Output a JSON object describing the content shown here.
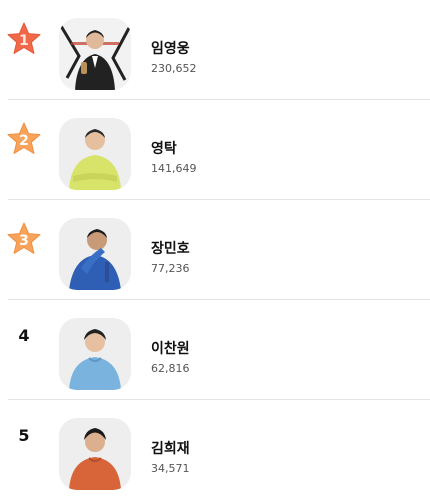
{
  "colors": {
    "star_gold_1": "#f06a4a",
    "star_fill_1": "#f47d54",
    "star_fill_2": "#f7a35c",
    "star_fill_3": "#f7a35c",
    "rank_text_star_1": "#c0392b",
    "rank_text_star": "#ffffff",
    "divider": "#e4e4e4",
    "avatar_bg": "#eeeeee"
  },
  "ranking": [
    {
      "rank": "1",
      "badge_icon": "star-icon",
      "name": "임영웅",
      "count": "230,652",
      "avatar_icon": "person-photo-icon"
    },
    {
      "rank": "2",
      "badge_icon": "star-icon",
      "name": "영탁",
      "count": "141,649",
      "avatar_icon": "person-photo-icon"
    },
    {
      "rank": "3",
      "badge_icon": "star-icon",
      "name": "장민호",
      "count": "77,236",
      "avatar_icon": "person-photo-icon"
    },
    {
      "rank": "4",
      "badge_icon": "none",
      "name": "이찬원",
      "count": "62,816",
      "avatar_icon": "person-photo-icon"
    },
    {
      "rank": "5",
      "badge_icon": "none",
      "name": "김희재",
      "count": "34,571",
      "avatar_icon": "person-photo-icon"
    }
  ]
}
